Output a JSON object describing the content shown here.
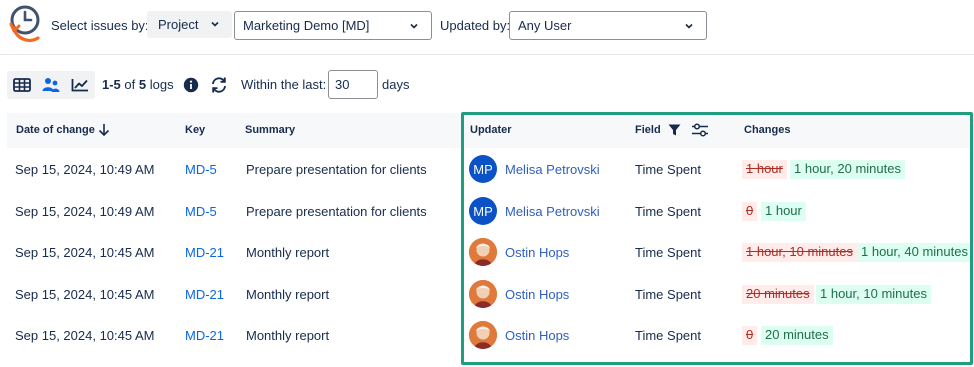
{
  "filters": {
    "select_by_label": "Select issues by:",
    "select_by_value": "Project",
    "project_value": "Marketing Demo [MD]",
    "updated_by_label": "Updated by:",
    "updated_by_value": "Any User"
  },
  "toolbar": {
    "range": "1-5",
    "of_word": "of",
    "total": "5",
    "logs_word": "logs",
    "within_label": "Within the last:",
    "days_value": "30",
    "days_label": "days"
  },
  "columns": {
    "date": "Date of change",
    "key": "Key",
    "summary": "Summary",
    "updater": "Updater",
    "field": "Field",
    "changes": "Changes"
  },
  "rows": [
    {
      "date": "Sep 15, 2024, 10:49 AM",
      "key": "MD-5",
      "summary": "Prepare presentation for clients",
      "avatar_initials": "MP",
      "updater": "Melisa Petrovski",
      "field": "Time Spent",
      "old": "1 hour",
      "new": "1 hour, 20 minutes"
    },
    {
      "date": "Sep 15, 2024, 10:49 AM",
      "key": "MD-5",
      "summary": "Prepare presentation for clients",
      "avatar_initials": "MP",
      "updater": "Melisa Petrovski",
      "field": "Time Spent",
      "old": "0",
      "new": "1 hour"
    },
    {
      "date": "Sep 15, 2024, 10:45 AM",
      "key": "MD-21",
      "summary": "Monthly report",
      "avatar_initials": "",
      "updater": "Ostin Hops",
      "field": "Time Spent",
      "old": "1 hour, 10 minutes",
      "new": "1 hour, 40 minutes"
    },
    {
      "date": "Sep 15, 2024, 10:45 AM",
      "key": "MD-21",
      "summary": "Monthly report",
      "avatar_initials": "",
      "updater": "Ostin Hops",
      "field": "Time Spent",
      "old": "20 minutes",
      "new": "1 hour, 10 minutes"
    },
    {
      "date": "Sep 15, 2024, 10:45 AM",
      "key": "MD-21",
      "summary": "Monthly report",
      "avatar_initials": "",
      "updater": "Ostin Hops",
      "field": "Time Spent",
      "old": "0",
      "new": "20 minutes"
    }
  ],
  "colors": {
    "accent": "#0c66e4",
    "highlight_border": "#1e9e7e",
    "old_bg": "#ffeceb",
    "new_bg": "#dcfff1"
  }
}
